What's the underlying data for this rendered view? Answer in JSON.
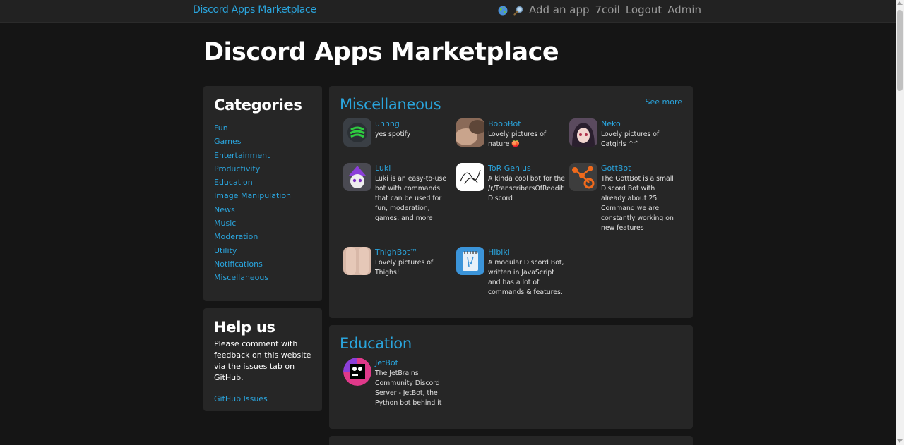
{
  "navbar": {
    "brand": "Discord Apps Marketplace",
    "icons": [
      "globe-icon",
      "search-icon"
    ],
    "links": [
      "Add an app",
      "7coil",
      "Logout",
      "Admin"
    ]
  },
  "page": {
    "title": "Discord Apps Marketplace"
  },
  "categories": {
    "heading": "Categories",
    "items": [
      "Fun",
      "Games",
      "Entertainment",
      "Productivity",
      "Education",
      "Image Manipulation",
      "News",
      "Music",
      "Moderation",
      "Utility",
      "Notifications",
      "Miscellaneous"
    ]
  },
  "help": {
    "heading": "Help us",
    "text": "Please comment with feedback on this website via the issues tab on GitHub.",
    "link": "GitHub Issues"
  },
  "sections": {
    "misc": {
      "title": "Miscellaneous",
      "see_more": "See more",
      "apps": [
        {
          "name": "uhhng",
          "desc": "yes spotify",
          "icon": "green-swirl-icon"
        },
        {
          "name": "BoobBot",
          "desc": "Lovely pictures of nature 🍑",
          "icon": "bot-avatar-icon"
        },
        {
          "name": "Neko",
          "desc": "Lovely pictures of Catgirls ^^",
          "icon": "anime-girl-icon"
        },
        {
          "name": "Luki",
          "desc": "Luki is an easy-to-use bot with commands that can be used for fun, moderation, games, and more!",
          "icon": "purple-wizard-icon"
        },
        {
          "name": "ToR Genius",
          "desc": "A kinda cool bot for the /r/TranscribersOfReddit Discord",
          "icon": "scribble-logo-icon"
        },
        {
          "name": "GottBot",
          "desc": "The GottBot is a small Discord Bot with already about 25 Command we are constantly working on new features",
          "icon": "orange-nodes-icon"
        },
        {
          "name": "ThighBot™",
          "desc": "Lovely pictures of Thighs!",
          "icon": "bot-avatar-icon"
        },
        {
          "name": "Hibiki",
          "desc": "A modular Discord Bot, written in JavaScript and has a lot of commands & features.",
          "icon": "notepad-icon"
        }
      ]
    },
    "edu": {
      "title": "Education",
      "apps": [
        {
          "name": "JetBot",
          "desc": "The JetBrains Community Discord Server - JetBot, the Python bot behind it",
          "icon": "jetbrains-logo-icon"
        }
      ]
    }
  },
  "colors": {
    "accent": "#2aa4dc",
    "background": "#151515",
    "panel": "#262626",
    "navbar": "#222222"
  }
}
